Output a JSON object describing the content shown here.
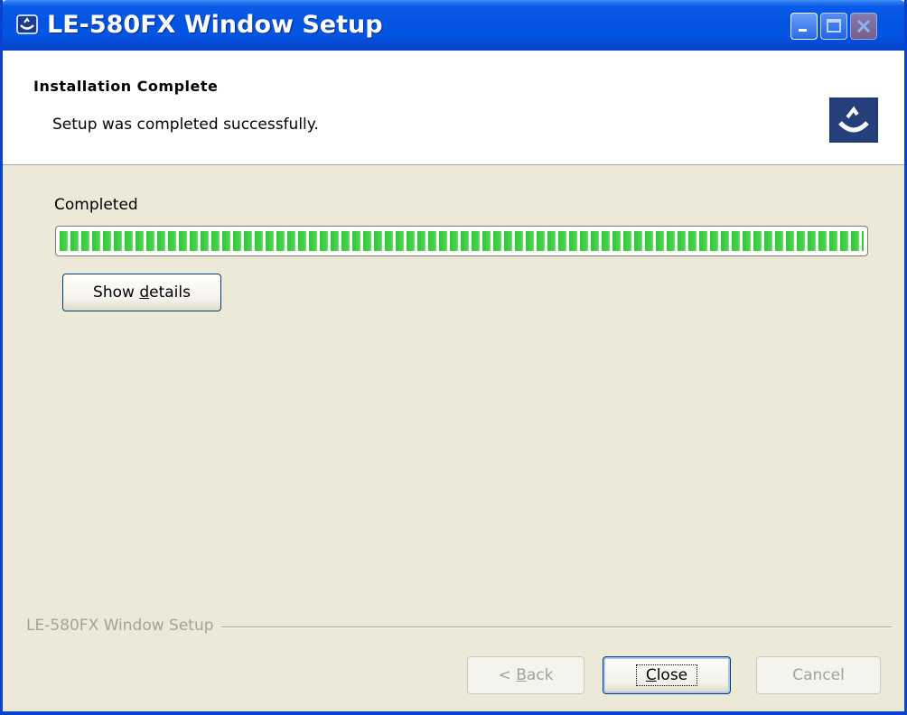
{
  "window": {
    "title": "LE-580FX Window Setup"
  },
  "header": {
    "title": "Installation Complete",
    "subtitle": "Setup was completed successfully."
  },
  "progress": {
    "label": "Completed",
    "value": 1.0
  },
  "buttons": {
    "details_pre": "Show ",
    "details_access": "d",
    "details_post": "etails",
    "back_pre": "< ",
    "back_access": "B",
    "back_post": "ack",
    "close_access": "C",
    "close_post": "lose",
    "cancel": "Cancel"
  },
  "footer": {
    "branding": "LE-580FX Window Setup"
  },
  "colors": {
    "titlebar": "#0454e2",
    "progress_fill": "#46d34a",
    "dialog_bg": "#ece9d8"
  },
  "icons": {
    "app": "setup-app-icon",
    "header_logo": "setup-logo-icon"
  }
}
